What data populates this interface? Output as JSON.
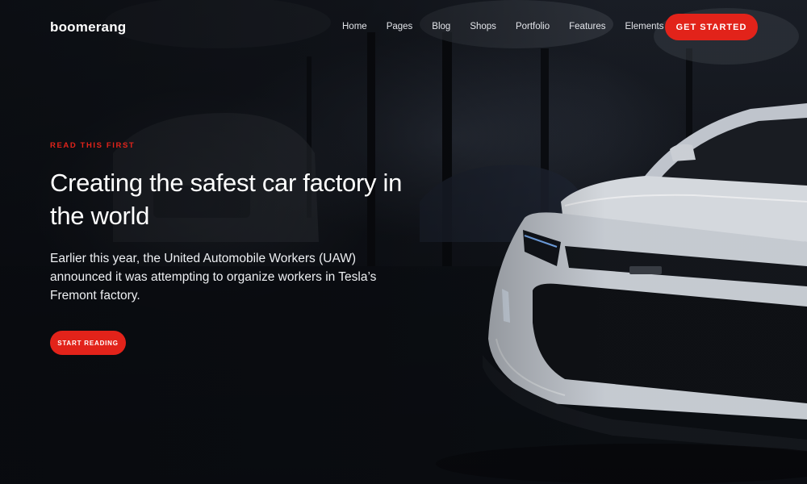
{
  "brand": {
    "logo_text": "boomerang"
  },
  "nav": {
    "items": [
      {
        "label": "Home"
      },
      {
        "label": "Pages"
      },
      {
        "label": "Blog"
      },
      {
        "label": "Shops"
      },
      {
        "label": "Portfolio"
      },
      {
        "label": "Features"
      },
      {
        "label": "Elements"
      }
    ],
    "cta_label": "GET STARTED"
  },
  "hero": {
    "eyebrow": "READ THIS FIRST",
    "headline": "Creating the safest car factory in the world",
    "lead": "Earlier this year, the United Automobile Workers (UAW) announced it was attempting to organize workers in Tesla’s Fremont factory.",
    "button_label": "START READING"
  },
  "colors": {
    "accent": "#e2231a",
    "background": "#101319",
    "text": "#ffffff"
  },
  "background_image": "dark-garage-white-sports-car"
}
